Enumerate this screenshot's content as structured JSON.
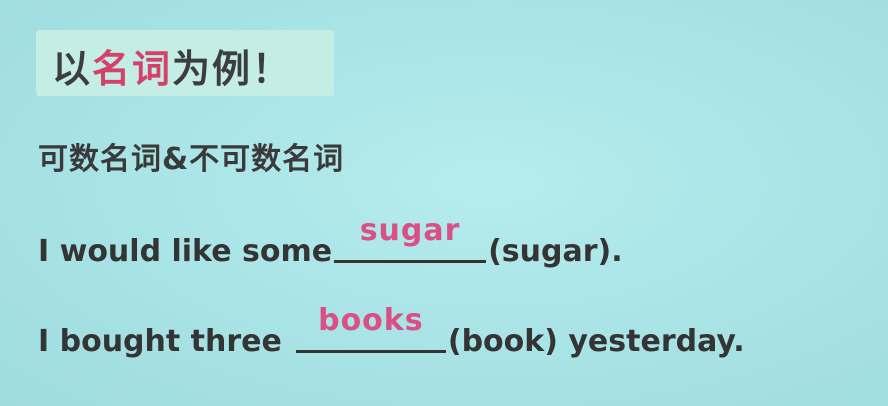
{
  "slide": {
    "heading_prefix": "以",
    "heading_accent": "名词",
    "heading_suffix": "为例！",
    "subheading": "可数名词&不可数名词",
    "colors": {
      "background": "#a9e4e6",
      "heading_box": "#c4ede6",
      "accent": "#d4426a",
      "answer": "#d94f86",
      "text": "#343434"
    },
    "sentences": [
      {
        "before": "I would like some",
        "answer": "sugar",
        "after": "(sugar)."
      },
      {
        "before": "I bought three",
        "answer": "books",
        "after": "(book) yesterday."
      }
    ]
  }
}
